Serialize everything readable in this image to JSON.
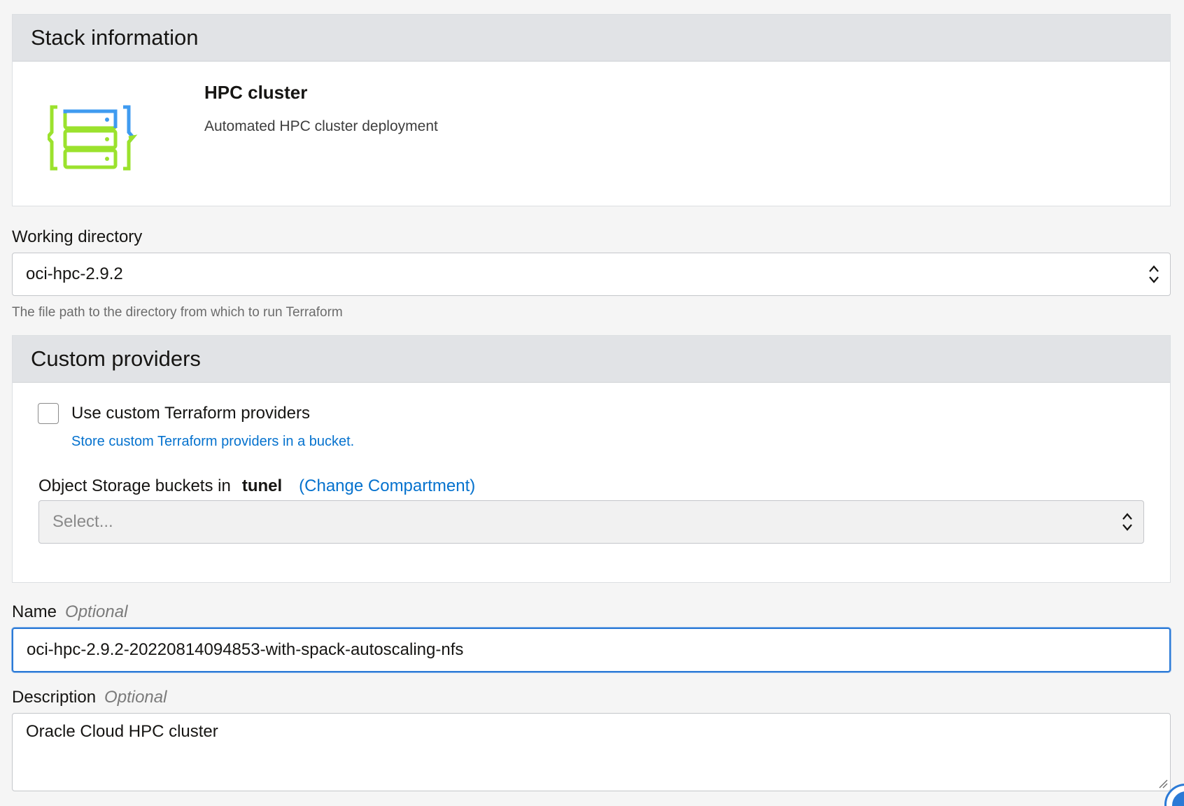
{
  "stack_info": {
    "header": "Stack information",
    "name": "HPC cluster",
    "description": "Automated HPC cluster deployment",
    "logo_icon": "server-stack-icon"
  },
  "working_directory": {
    "label": "Working directory",
    "value": "oci-hpc-2.9.2",
    "hint": "The file path to the directory from which to run Terraform"
  },
  "custom_providers": {
    "header": "Custom providers",
    "checkbox_label": "Use custom Terraform providers",
    "checkbox_checked": false,
    "help_link": "Store custom Terraform providers in a bucket.",
    "bucket_label": "Object Storage buckets in",
    "compartment": "tunel",
    "change_compartment": "(Change Compartment)",
    "bucket_placeholder": "Select..."
  },
  "name_field": {
    "label": "Name",
    "optional": "Optional",
    "value": "oci-hpc-2.9.2-20220814094853-with-spack-autoscaling-nfs"
  },
  "description_field": {
    "label": "Description",
    "optional": "Optional",
    "value": "Oracle Cloud HPC cluster"
  },
  "colors": {
    "accent": "#0572ce",
    "focus": "#2b7ad6",
    "logo_green": "#9be22d",
    "logo_blue": "#3f9bf0"
  }
}
